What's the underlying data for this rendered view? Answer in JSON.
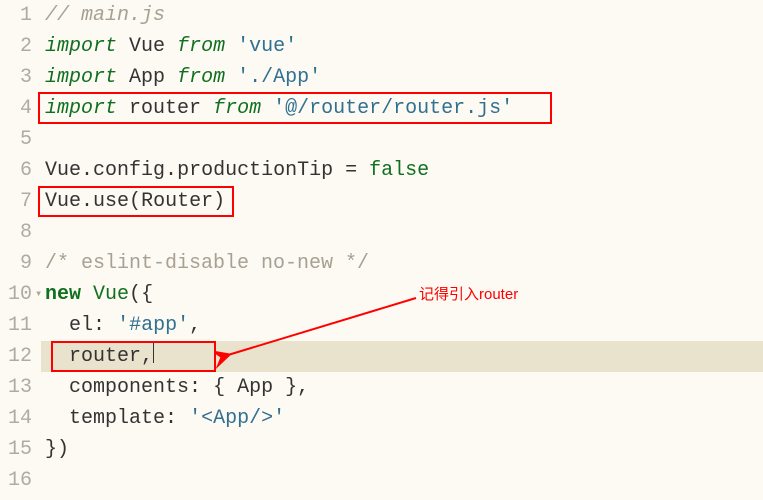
{
  "gutter": [
    "1",
    "2",
    "3",
    "4",
    "5",
    "6",
    "7",
    "8",
    "9",
    "10",
    "11",
    "12",
    "13",
    "14",
    "15",
    "16"
  ],
  "lines": {
    "l1": {
      "comment": "// main.js"
    },
    "l2": {
      "kw1": "import",
      "sp": " ",
      "id": "Vue",
      "sp2": " ",
      "kw2": "from",
      "sp3": " ",
      "str": "'vue'"
    },
    "l3": {
      "kw1": "import",
      "sp": " ",
      "id": "App",
      "sp2": " ",
      "kw2": "from",
      "sp3": " ",
      "str": "'./App'"
    },
    "l4": {
      "kw1": "import",
      "sp": " ",
      "id": "router",
      "sp2": " ",
      "kw2": "from",
      "sp3": " ",
      "str": "'@/router/router.js'"
    },
    "l6": {
      "id": "Vue",
      "dot1": ".",
      "p1": "config",
      "dot2": ".",
      "p2": "productionTip",
      "sp": " ",
      "op": "=",
      "sp2": " ",
      "val": "false"
    },
    "l7": {
      "id": "Vue",
      "dot": ".",
      "m": "use",
      "lp": "(",
      "arg": "Router",
      "rp": ")"
    },
    "l9": {
      "comment": "/* eslint-disable no-new */"
    },
    "l10": {
      "nw": "new",
      "sp": " ",
      "cls": "Vue",
      "lp": "(",
      "lb": "{"
    },
    "l11": {
      "indent": "  ",
      "prop": "el",
      "colon": ":",
      "sp": " ",
      "str": "'#app'",
      "comma": ","
    },
    "l12": {
      "indent": "  ",
      "id": "router",
      "comma": ","
    },
    "l13": {
      "indent": "  ",
      "prop": "components",
      "colon": ":",
      "sp": " ",
      "lb": "{",
      "sp2": " ",
      "id": "App",
      "sp3": " ",
      "rb": "}",
      "comma": ","
    },
    "l14": {
      "indent": "  ",
      "prop": "template",
      "colon": ":",
      "sp": " ",
      "q": "'",
      "tag": "<App/>",
      "q2": "'"
    },
    "l15": {
      "rb": "}",
      "rp": ")"
    }
  },
  "annotation": {
    "text": "记得引入router"
  },
  "markers": {
    "fold_open": "▾"
  }
}
